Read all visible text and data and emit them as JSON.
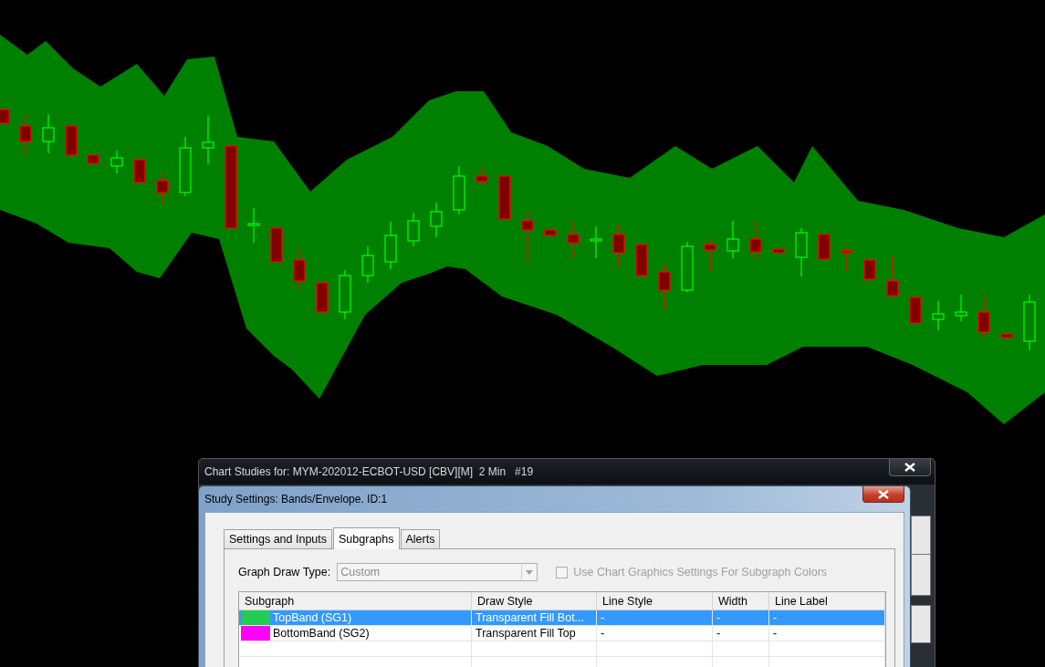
{
  "chart_window": {
    "title": "Chart Studies for: MYM-202012-ECBOT-USD [CBV][M]  2 Min   #19"
  },
  "dialog": {
    "title": "Study Settings: Bands/Envelope. ID:1",
    "tabs": [
      {
        "label": "Settings and Inputs",
        "selected": false
      },
      {
        "label": "Subgraphs",
        "selected": true
      },
      {
        "label": "Alerts",
        "selected": false
      }
    ],
    "graph_draw_type": {
      "label": "Graph Draw Type:",
      "value": "Custom",
      "disabled": true
    },
    "use_chart_colors": {
      "label": "Use Chart Graphics Settings For Subgraph Colors",
      "checked": false,
      "disabled": true
    },
    "table": {
      "columns": [
        "Subgraph",
        "Draw Style",
        "Line Style",
        "Width",
        "Line Label"
      ],
      "rows": [
        {
          "selected": true,
          "color": "#22cc55",
          "cells": [
            "TopBand (SG1)",
            "Transparent Fill Bot...",
            "-",
            "-",
            "-"
          ]
        },
        {
          "selected": false,
          "color": "#ff00ff",
          "cells": [
            "BottomBand (SG2)",
            "Transparent Fill Top",
            "-",
            "-",
            "-"
          ]
        }
      ]
    }
  }
}
